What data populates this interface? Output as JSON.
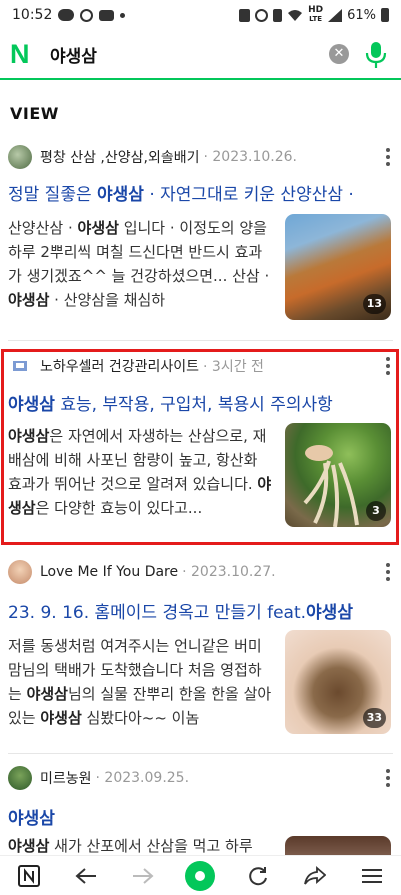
{
  "status_bar": {
    "time": "10:52",
    "battery": "61%",
    "network": "HD",
    "network_sub": "LTE",
    "signal_icons": [
      "talk-icon",
      "tiktok-icon",
      "youtube-icon",
      "dot-icon",
      "lock-icon",
      "alarm-icon",
      "vibrate-icon",
      "wifi-icon",
      "signal-icon",
      "battery-icon"
    ]
  },
  "search": {
    "logo": "N",
    "query": "야생삼",
    "clear_icon": "clear-icon",
    "mic_icon": "microphone-icon",
    "brand_color": "#03c75a"
  },
  "section": {
    "title": "VIEW"
  },
  "posts": [
    {
      "author": "평창 산삼 ,산양삼,외솔배기",
      "date": "· 2023.10.26.",
      "title_pre": "정말 질좋은 ",
      "title_bold": "야생삼",
      "title_post": " · 자연그대로 키운 산양산삼 ·",
      "snippet_parts": [
        {
          "t": "산양산삼 · ",
          "b": false
        },
        {
          "t": "야생삼",
          "b": true
        },
        {
          "t": " 입니다 · 이정도의 양을 하루 2뿌리씩 며칠 드신다면 반드시 효과가 생기겠죠^^ 늘 건강하셨으면... 산삼 · ",
          "b": false
        },
        {
          "t": "야생삼",
          "b": true
        },
        {
          "t": " · 산양삼을 채심하",
          "b": false
        }
      ],
      "thumb_count": "13"
    },
    {
      "author": "노하우셀러 건강관리사이트",
      "date": "· 3시간 전",
      "title_pre": "",
      "title_bold": "야생삼",
      "title_post": " 효능, 부작용, 구입처, 복용시 주의사항",
      "snippet_parts": [
        {
          "t": "야생삼",
          "b": true
        },
        {
          "t": "은 자연에서 자생하는 산삼으로, 재배삼에 비해 사포닌 함량이 높고, 항산화 효과가 뛰어난 것으로 알려져 있습니다. ",
          "b": false
        },
        {
          "t": "야생삼",
          "b": true
        },
        {
          "t": "은 다양한 효능이 있다고...",
          "b": false
        }
      ],
      "thumb_count": "3"
    },
    {
      "author": "Love Me If You Dare",
      "date": "· 2023.10.27.",
      "title_pre": "23. 9. 16. 홈메이드 경옥고 만들기 feat.",
      "title_bold": "야생삼",
      "title_post": "",
      "snippet_parts": [
        {
          "t": "저를 동생처럼 여겨주시는 언니같은 버미맘님의 택배가 도착했습니다 처음 영접하는 ",
          "b": false
        },
        {
          "t": "야생삼",
          "b": true
        },
        {
          "t": "님의 실물 잔뿌리 한올 한올 살아있는 ",
          "b": false
        },
        {
          "t": "야생삼",
          "b": true
        },
        {
          "t": " 심봤다아~~ 이놈",
          "b": false
        }
      ],
      "thumb_count": "33"
    },
    {
      "author": "미르농원",
      "date": "· 2023.09.25.",
      "title_pre": "",
      "title_bold": "야생삼",
      "title_post": "",
      "snippet_parts": [
        {
          "t": "야생삼",
          "b": true
        },
        {
          "t": " 새가 산포에서 산삼을 먹고 하루",
          "b": false
        }
      ],
      "thumb_count": ""
    }
  ],
  "bottom_nav": {
    "items": [
      "naver-home-icon",
      "back-icon",
      "forward-icon",
      "green-dot-icon",
      "refresh-icon",
      "share-icon",
      "menu-icon"
    ]
  }
}
